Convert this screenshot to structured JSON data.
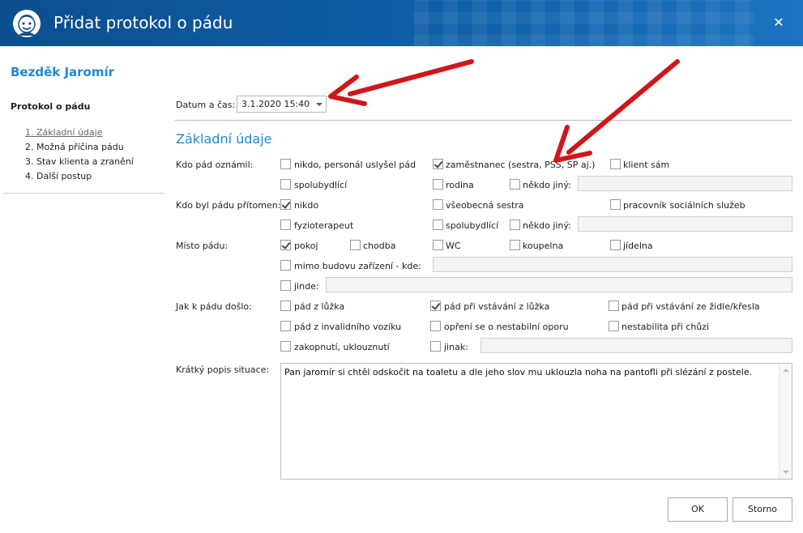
{
  "window": {
    "title": "Přidat protokol o pádu",
    "close_glyph": "✕"
  },
  "sidebar": {
    "client_name": "Bezděk Jaromír",
    "section": "Protokol o pádu",
    "items": [
      {
        "label": "1. Základní údaje",
        "active": true
      },
      {
        "label": "2. Možná příčina pádu"
      },
      {
        "label": "3. Stav klienta a zranění"
      },
      {
        "label": "4. Další postup"
      }
    ]
  },
  "form": {
    "datetime_label": "Datum a čas:",
    "datetime_value": "3.1.2020 15:40",
    "group_title": "Základní údaje",
    "reported_by": {
      "label": "Kdo pád oznámil:",
      "options": [
        {
          "label": "nikdo, personál uslyšel pád",
          "checked": false
        },
        {
          "label": "zaměstnanec (sestra, PSS, SP aj.)",
          "checked": true
        },
        {
          "label": "klient sám",
          "checked": false
        },
        {
          "label": "spolubydlící",
          "checked": false
        },
        {
          "label": "rodina",
          "checked": false
        },
        {
          "label": "někdo jiný:",
          "checked": false
        }
      ]
    },
    "present": {
      "label": "Kdo byl pádu přítomen:",
      "options": [
        {
          "label": "nikdo",
          "checked": true
        },
        {
          "label": "všeobecná sestra",
          "checked": false
        },
        {
          "label": "pracovník sociálních služeb",
          "checked": false
        },
        {
          "label": "fyzioterapeut",
          "checked": false
        },
        {
          "label": "spolubydlící",
          "checked": false
        },
        {
          "label": "někdo jiný:",
          "checked": false
        }
      ]
    },
    "place": {
      "label": "Místo pádu:",
      "options": [
        {
          "label": "pokoj",
          "checked": true
        },
        {
          "label": "chodba",
          "checked": false
        },
        {
          "label": "WC",
          "checked": false
        },
        {
          "label": "koupelna",
          "checked": false
        },
        {
          "label": "jídelna",
          "checked": false
        },
        {
          "label": "mimo budovu zařízení - kde:",
          "checked": false
        },
        {
          "label": "jinde:",
          "checked": false
        }
      ]
    },
    "how": {
      "label": "Jak k pádu došlo:",
      "options": [
        {
          "label": "pád z lůžka",
          "checked": false
        },
        {
          "label": "pád při vstávání z lůžka",
          "checked": true
        },
        {
          "label": "pád při vstávání ze židle/křesla",
          "checked": false
        },
        {
          "label": "pád z invalidního vozíku",
          "checked": false
        },
        {
          "label": "opření se o nestabilní oporu",
          "checked": false
        },
        {
          "label": "nestabilita při chůzi",
          "checked": false
        },
        {
          "label": "zakopnutí, uklouznutí",
          "checked": false
        },
        {
          "label": "jinak:",
          "checked": false
        }
      ]
    },
    "description": {
      "label": "Krátký popis situace:",
      "value": "Pan jaromír si chtěl odskočit na toaletu a dle jeho slov mu uklouzla noha na pantofli při slézání z postele."
    }
  },
  "buttons": {
    "ok": "OK",
    "cancel": "Storno"
  },
  "colors": {
    "titlebar": "#0f5fa8",
    "accent": "#1d8ad4",
    "annotation_arrow": "#d0161b"
  }
}
